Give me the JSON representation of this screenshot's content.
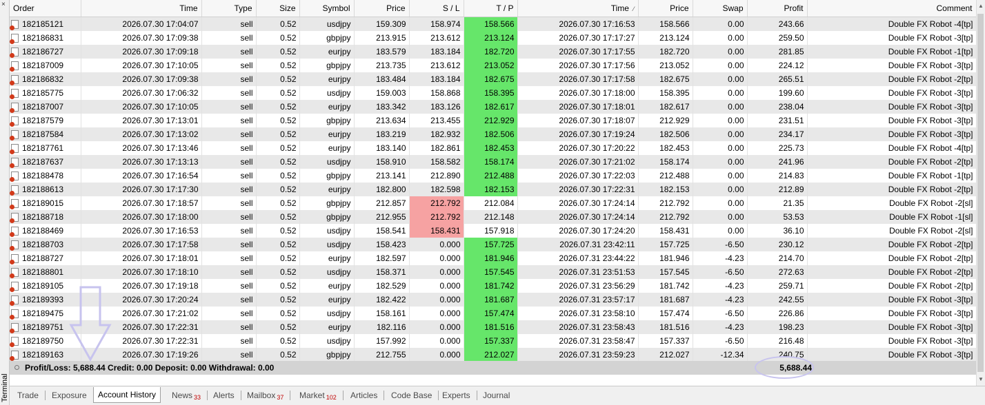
{
  "sidebar": {
    "label": "Terminal",
    "close_glyph": "×"
  },
  "columns": [
    "Order",
    "Time",
    "Type",
    "Size",
    "Symbol",
    "Price",
    "S / L",
    "T / P",
    "Time",
    "Price",
    "Swap",
    "Profit",
    "Comment"
  ],
  "sort_indicator": "⁄",
  "rows": [
    [
      "182185121",
      "2026.07.30 17:04:07",
      "sell",
      "0.52",
      "usdjpy",
      "159.309",
      "158.974",
      "158.566",
      "2026.07.30 17:16:53",
      "158.566",
      "0.00",
      "243.66",
      "Double FX Robot -4[tp]"
    ],
    [
      "182186831",
      "2026.07.30 17:09:38",
      "sell",
      "0.52",
      "gbpjpy",
      "213.915",
      "213.612",
      "213.124",
      "2026.07.30 17:17:27",
      "213.124",
      "0.00",
      "259.50",
      "Double FX Robot -3[tp]"
    ],
    [
      "182186727",
      "2026.07.30 17:09:18",
      "sell",
      "0.52",
      "eurjpy",
      "183.579",
      "183.184",
      "182.720",
      "2026.07.30 17:17:55",
      "182.720",
      "0.00",
      "281.85",
      "Double FX Robot -1[tp]"
    ],
    [
      "182187009",
      "2026.07.30 17:10:05",
      "sell",
      "0.52",
      "gbpjpy",
      "213.735",
      "213.612",
      "213.052",
      "2026.07.30 17:17:56",
      "213.052",
      "0.00",
      "224.12",
      "Double FX Robot -3[tp]"
    ],
    [
      "182186832",
      "2026.07.30 17:09:38",
      "sell",
      "0.52",
      "eurjpy",
      "183.484",
      "183.184",
      "182.675",
      "2026.07.30 17:17:58",
      "182.675",
      "0.00",
      "265.51",
      "Double FX Robot -2[tp]"
    ],
    [
      "182185775",
      "2026.07.30 17:06:32",
      "sell",
      "0.52",
      "usdjpy",
      "159.003",
      "158.868",
      "158.395",
      "2026.07.30 17:18:00",
      "158.395",
      "0.00",
      "199.60",
      "Double FX Robot -3[tp]"
    ],
    [
      "182187007",
      "2026.07.30 17:10:05",
      "sell",
      "0.52",
      "eurjpy",
      "183.342",
      "183.126",
      "182.617",
      "2026.07.30 17:18:01",
      "182.617",
      "0.00",
      "238.04",
      "Double FX Robot -3[tp]"
    ],
    [
      "182187579",
      "2026.07.30 17:13:01",
      "sell",
      "0.52",
      "gbpjpy",
      "213.634",
      "213.455",
      "212.929",
      "2026.07.30 17:18:07",
      "212.929",
      "0.00",
      "231.51",
      "Double FX Robot -3[tp]"
    ],
    [
      "182187584",
      "2026.07.30 17:13:02",
      "sell",
      "0.52",
      "eurjpy",
      "183.219",
      "182.932",
      "182.506",
      "2026.07.30 17:19:24",
      "182.506",
      "0.00",
      "234.17",
      "Double FX Robot -3[tp]"
    ],
    [
      "182187761",
      "2026.07.30 17:13:46",
      "sell",
      "0.52",
      "eurjpy",
      "183.140",
      "182.861",
      "182.453",
      "2026.07.30 17:20:22",
      "182.453",
      "0.00",
      "225.73",
      "Double FX Robot -4[tp]"
    ],
    [
      "182187637",
      "2026.07.30 17:13:13",
      "sell",
      "0.52",
      "usdjpy",
      "158.910",
      "158.582",
      "158.174",
      "2026.07.30 17:21:02",
      "158.174",
      "0.00",
      "241.96",
      "Double FX Robot -2[tp]"
    ],
    [
      "182188478",
      "2026.07.30 17:16:54",
      "sell",
      "0.52",
      "gbpjpy",
      "213.141",
      "212.890",
      "212.488",
      "2026.07.30 17:22:03",
      "212.488",
      "0.00",
      "214.83",
      "Double FX Robot -1[tp]"
    ],
    [
      "182188613",
      "2026.07.30 17:17:30",
      "sell",
      "0.52",
      "eurjpy",
      "182.800",
      "182.598",
      "182.153",
      "2026.07.30 17:22:31",
      "182.153",
      "0.00",
      "212.89",
      "Double FX Robot -2[tp]"
    ],
    [
      "182189015",
      "2026.07.30 17:18:57",
      "sell",
      "0.52",
      "gbpjpy",
      "212.857",
      "212.792",
      "212.084",
      "2026.07.30 17:24:14",
      "212.792",
      "0.00",
      "21.35",
      "Double FX Robot -2[sl]"
    ],
    [
      "182188718",
      "2026.07.30 17:18:00",
      "sell",
      "0.52",
      "gbpjpy",
      "212.955",
      "212.792",
      "212.148",
      "2026.07.30 17:24:14",
      "212.792",
      "0.00",
      "53.53",
      "Double FX Robot -1[sl]"
    ],
    [
      "182188469",
      "2026.07.30 17:16:53",
      "sell",
      "0.52",
      "usdjpy",
      "158.541",
      "158.431",
      "157.918",
      "2026.07.30 17:24:20",
      "158.431",
      "0.00",
      "36.10",
      "Double FX Robot -2[sl]"
    ],
    [
      "182188703",
      "2026.07.30 17:17:58",
      "sell",
      "0.52",
      "usdjpy",
      "158.423",
      "0.000",
      "157.725",
      "2026.07.31 23:42:11",
      "157.725",
      "-6.50",
      "230.12",
      "Double FX Robot -2[tp]"
    ],
    [
      "182188727",
      "2026.07.30 17:18:01",
      "sell",
      "0.52",
      "eurjpy",
      "182.597",
      "0.000",
      "181.946",
      "2026.07.31 23:44:22",
      "181.946",
      "-4.23",
      "214.70",
      "Double FX Robot -2[tp]"
    ],
    [
      "182188801",
      "2026.07.30 17:18:10",
      "sell",
      "0.52",
      "usdjpy",
      "158.371",
      "0.000",
      "157.545",
      "2026.07.31 23:51:53",
      "157.545",
      "-6.50",
      "272.63",
      "Double FX Robot -2[tp]"
    ],
    [
      "182189105",
      "2026.07.30 17:19:18",
      "sell",
      "0.52",
      "eurjpy",
      "182.529",
      "0.000",
      "181.742",
      "2026.07.31 23:56:29",
      "181.742",
      "-4.23",
      "259.71",
      "Double FX Robot -2[tp]"
    ],
    [
      "182189393",
      "2026.07.30 17:20:24",
      "sell",
      "0.52",
      "eurjpy",
      "182.422",
      "0.000",
      "181.687",
      "2026.07.31 23:57:17",
      "181.687",
      "-4.23",
      "242.55",
      "Double FX Robot -3[tp]"
    ],
    [
      "182189475",
      "2026.07.30 17:21:02",
      "sell",
      "0.52",
      "usdjpy",
      "158.161",
      "0.000",
      "157.474",
      "2026.07.31 23:58:10",
      "157.474",
      "-6.50",
      "226.86",
      "Double FX Robot -3[tp]"
    ],
    [
      "182189751",
      "2026.07.30 17:22:31",
      "sell",
      "0.52",
      "eurjpy",
      "182.116",
      "0.000",
      "181.516",
      "2026.07.31 23:58:43",
      "181.516",
      "-4.23",
      "198.23",
      "Double FX Robot -3[tp]"
    ],
    [
      "182189750",
      "2026.07.30 17:22:31",
      "sell",
      "0.52",
      "usdjpy",
      "157.992",
      "0.000",
      "157.337",
      "2026.07.31 23:58:47",
      "157.337",
      "-6.50",
      "216.48",
      "Double FX Robot -3[tp]"
    ],
    [
      "182189163",
      "2026.07.30 17:19:26",
      "sell",
      "0.52",
      "gbpjpy",
      "212.755",
      "0.000",
      "212.027",
      "2026.07.31 23:59:23",
      "212.027",
      "-12.34",
      "240.75",
      "Double FX Robot -3[tp]"
    ]
  ],
  "row_highlights": [
    "tp",
    "tp",
    "tp",
    "tp",
    "tp",
    "tp",
    "tp",
    "tp",
    "tp",
    "tp",
    "tp",
    "tp",
    "tp",
    "sl",
    "sl",
    "sl",
    "tp",
    "tp",
    "tp",
    "tp",
    "tp",
    "tp",
    "tp",
    "tp",
    "tp"
  ],
  "colors": {
    "tp_highlight": "#66e66a",
    "sl_highlight": "#f6a2a2",
    "annotation": "#c7c3ee"
  },
  "summary": {
    "text": "Profit/Loss: 5,688.44  Credit: 0.00  Deposit: 0.00  Withdrawal: 0.00",
    "profit_total": "5,688.44"
  },
  "tabs": [
    {
      "label": "Trade",
      "badge": ""
    },
    {
      "label": "Exposure",
      "badge": ""
    },
    {
      "label": "Account History",
      "badge": "",
      "active": true
    },
    {
      "label": "News",
      "badge": "33"
    },
    {
      "label": "Alerts",
      "badge": ""
    },
    {
      "label": "Mailbox",
      "badge": "37"
    },
    {
      "label": "Market",
      "badge": "102"
    },
    {
      "label": "Articles",
      "badge": ""
    },
    {
      "label": "Code Base",
      "badge": ""
    },
    {
      "label": "Experts",
      "badge": ""
    },
    {
      "label": "Journal",
      "badge": ""
    }
  ],
  "icons": {
    "row_icon": "order-document-icon",
    "annotation_arrow": "down-arrow-annotation-icon"
  }
}
